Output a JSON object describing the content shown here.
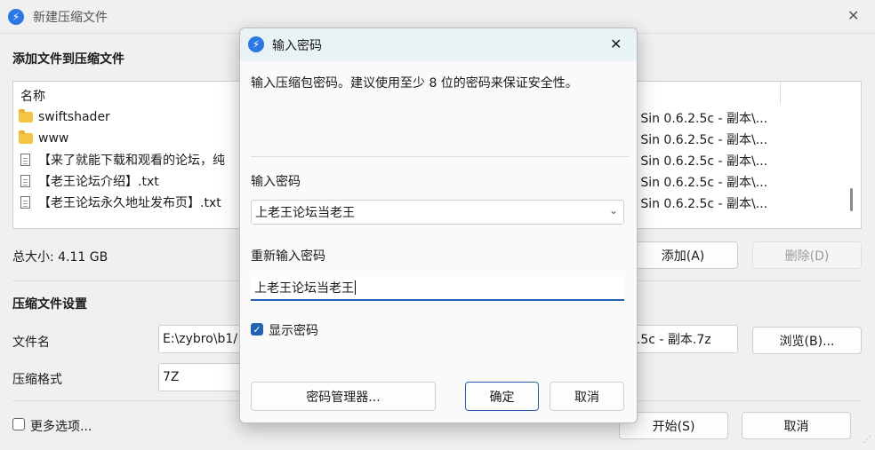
{
  "window": {
    "title": "新建压缩文件",
    "close_glyph": "✕"
  },
  "main": {
    "add_section_title": "添加文件到压缩文件",
    "list_header_name": "名称",
    "files": [
      {
        "name": "swiftshader",
        "kind": "folder",
        "path": "h Sin 0.6.2.5c - 副本\\..."
      },
      {
        "name": "www",
        "kind": "folder",
        "path": "h Sin 0.6.2.5c - 副本\\..."
      },
      {
        "name": "【来了就能下载和观看的论坛，纯",
        "kind": "file",
        "path": "h Sin 0.6.2.5c - 副本\\..."
      },
      {
        "name": "【老王论坛介绍】.txt",
        "kind": "file",
        "path": "h Sin 0.6.2.5c - 副本\\..."
      },
      {
        "name": "【老王论坛永久地址发布页】.txt",
        "kind": "file",
        "path": "h Sin 0.6.2.5c - 副本\\..."
      }
    ],
    "total_size": "总大小: 4.11 GB",
    "add_button": "添加(A)",
    "delete_button": "删除(D)",
    "settings_title": "压缩文件设置",
    "filename_label": "文件名",
    "filename_value_left": "E:\\zybro\\b1/",
    "filename_value_right": "2.5c - 副本.7z",
    "browse_button": "浏览(B)...",
    "format_label": "压缩格式",
    "format_value": "7Z",
    "more_options_label": "更多选项...",
    "start_button": "开始(S)",
    "cancel_button": "取消"
  },
  "dialog": {
    "title": "输入密码",
    "close_glyph": "✕",
    "description": "输入压缩包密码。建议使用至少 8 位的密码来保证安全性。",
    "password_label": "输入密码",
    "password_value": "上老王论坛当老王",
    "confirm_label": "重新输入密码",
    "confirm_value": "上老王论坛当老王",
    "show_password_label": "显示密码",
    "show_password_checked": true,
    "manager_button": "密码管理器...",
    "ok_button": "确定",
    "cancel_button": "取消"
  }
}
